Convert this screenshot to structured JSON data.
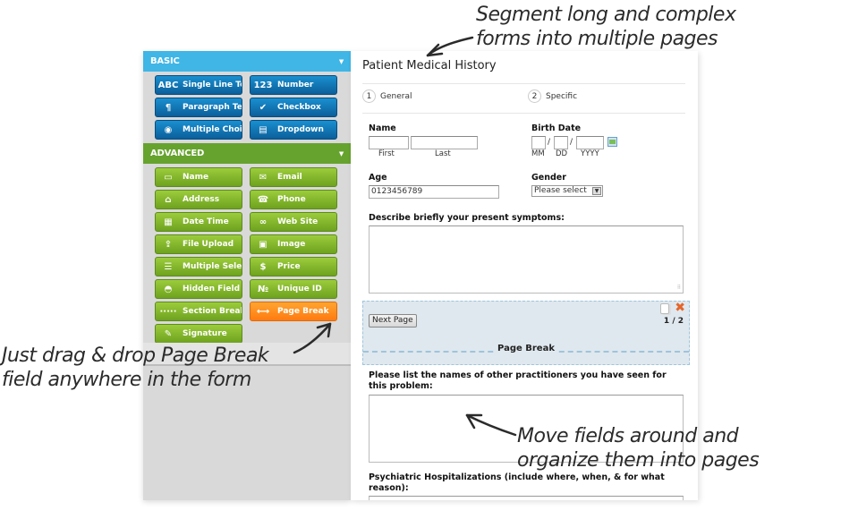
{
  "sidebar": {
    "basic": {
      "title": "BASIC",
      "caret": "▼",
      "buttons": [
        {
          "label": "Single Line Text",
          "icon": "abc-icon",
          "glyph": "ABC"
        },
        {
          "label": "Number",
          "icon": "number-icon",
          "glyph": "123"
        },
        {
          "label": "Paragraph Text",
          "icon": "paragraph-icon",
          "glyph": "¶"
        },
        {
          "label": "Checkbox",
          "icon": "checkbox-icon",
          "glyph": "✔"
        },
        {
          "label": "Multiple Choice",
          "icon": "radio-icon",
          "glyph": "◉"
        },
        {
          "label": "Dropdown",
          "icon": "dropdown-icon",
          "glyph": "▤"
        }
      ]
    },
    "advanced": {
      "title": "ADVANCED",
      "caret": "▼",
      "buttons": [
        {
          "label": "Name",
          "icon": "name-card-icon",
          "glyph": "▭"
        },
        {
          "label": "Email",
          "icon": "envelope-icon",
          "glyph": "✉"
        },
        {
          "label": "Address",
          "icon": "house-icon",
          "glyph": "⌂"
        },
        {
          "label": "Phone",
          "icon": "phone-icon",
          "glyph": "☎"
        },
        {
          "label": "Date Time",
          "icon": "calendar-icon",
          "glyph": "▦"
        },
        {
          "label": "Web Site",
          "icon": "link-icon",
          "glyph": "∞"
        },
        {
          "label": "File Upload",
          "icon": "file-upload-icon",
          "glyph": "⇪"
        },
        {
          "label": "Image",
          "icon": "image-icon",
          "glyph": "▣"
        },
        {
          "label": "Multiple Select",
          "icon": "multi-select-icon",
          "glyph": "☰"
        },
        {
          "label": "Price",
          "icon": "dollar-icon",
          "glyph": "$"
        },
        {
          "label": "Hidden Field",
          "icon": "mask-icon",
          "glyph": "◓"
        },
        {
          "label": "Unique ID",
          "icon": "id-icon",
          "glyph": "№"
        },
        {
          "label": "Section Break",
          "icon": "section-break-icon",
          "glyph": "·····"
        },
        {
          "label": "Page Break",
          "icon": "page-break-icon",
          "glyph": "⟷"
        },
        {
          "label": "Signature",
          "icon": "signature-icon",
          "glyph": "✎"
        }
      ]
    }
  },
  "form": {
    "title": "Patient Medical History",
    "steps": [
      {
        "num": "1",
        "label": "General"
      },
      {
        "num": "2",
        "label": "Specific"
      }
    ],
    "name": {
      "label": "Name",
      "first": "First",
      "last": "Last",
      "first_value": "",
      "last_value": ""
    },
    "birth_date": {
      "label": "Birth Date",
      "mm": "MM",
      "dd": "DD",
      "yyyy": "YYYY",
      "sep": "/"
    },
    "age": {
      "label": "Age",
      "value": "0123456789"
    },
    "gender": {
      "label": "Gender",
      "selected": "Please select",
      "arrow": "▼"
    },
    "symptoms": {
      "label": "Describe briefly your present symptoms:",
      "value": ""
    },
    "page_break": {
      "next_label": "Next Page",
      "page_count": "1 / 2",
      "label": "Page Break",
      "delete_glyph": "✖"
    },
    "practitioners": {
      "label": "Please list the names of other practitioners you have seen for this problem:",
      "value": ""
    },
    "hospitalizations": {
      "label": "Psychiatric Hospitalizations (include where, when, & for what reason):"
    }
  },
  "annotations": {
    "top": [
      "Segment long and complex",
      "forms into multiple pages"
    ],
    "left": [
      "Just drag & drop Page Break",
      "field anywhere in the form"
    ],
    "right": [
      "Move fields around and",
      "organize them into pages"
    ]
  }
}
